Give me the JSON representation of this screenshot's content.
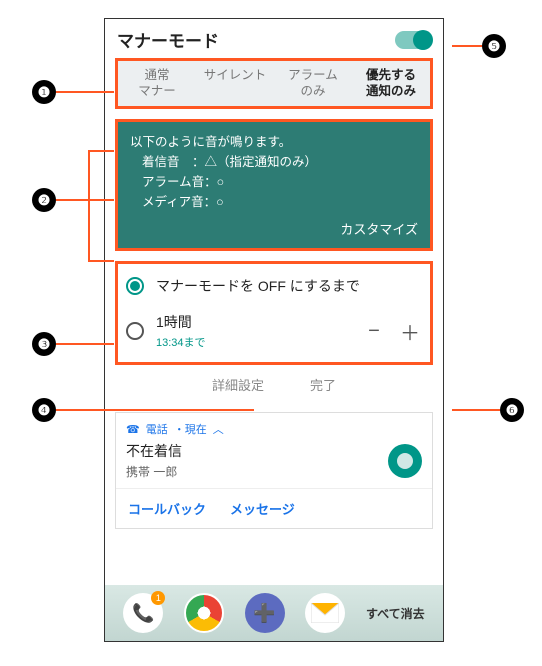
{
  "header": {
    "title": "マナーモード"
  },
  "tabs": [
    {
      "l1": "通常",
      "l2": "マナー"
    },
    {
      "l1": "サイレント",
      "l2": ""
    },
    {
      "l1": "アラーム",
      "l2": "のみ"
    },
    {
      "l1": "優先する",
      "l2": "通知のみ"
    }
  ],
  "info": {
    "heading": "以下のように音が鳴ります。",
    "line1": "着信音　：△（指定通知のみ）",
    "line2": "アラーム音：○",
    "line3": "メディア音：○",
    "customize": "カスタマイズ"
  },
  "duration": {
    "option1": "マナーモードを OFF にするまで",
    "option2_label": "1時間",
    "option2_sub": "13:34まで",
    "minus": "−",
    "plus": "＋"
  },
  "actions": {
    "advanced": "詳細設定",
    "done": "完了"
  },
  "notification": {
    "app": "電話",
    "time": "・現在",
    "chevron": "︿",
    "title": "不在着信",
    "subtitle": "携帯 一郎",
    "action1": "コールバック",
    "action2": "メッセージ"
  },
  "dock": {
    "clear": "すべて消去",
    "badge": "1"
  },
  "callouts": {
    "c1": "❶",
    "c2": "❷",
    "c3": "❸",
    "c4": "❹",
    "c5": "❺",
    "c6": "❻"
  }
}
